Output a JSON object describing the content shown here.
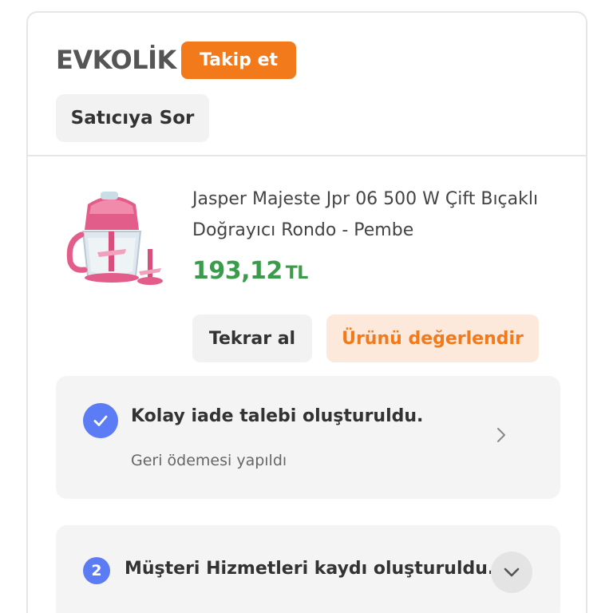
{
  "seller": {
    "name": "EVKOLİK",
    "follow_label": "Takip et",
    "ask_label": "Satıcıya Sor"
  },
  "product": {
    "title": "Jasper Majeste Jpr 06 500 W Çift Bıçaklı Doğrayıcı Rondo - Pembe",
    "price": "193,12",
    "currency": "TL",
    "image_icon": "food-chopper-pink",
    "rebuy_label": "Tekrar al",
    "review_label": "Ürünü değerlendir"
  },
  "return_status": {
    "title": "Kolay iade talebi oluşturuldu.",
    "subtitle": "Geri ödemesi yapıldı",
    "icon": "check-circle-icon"
  },
  "service_ticket": {
    "number": "2",
    "title": "Müşteri Hizmetleri kaydı oluşturuldu.",
    "icon": "chevron-down-icon"
  },
  "colors": {
    "brand_orange": "#f27a1a",
    "price_green": "#3a9b4b",
    "status_blue": "#5b7cf5",
    "review_bg": "#fde9dc"
  }
}
